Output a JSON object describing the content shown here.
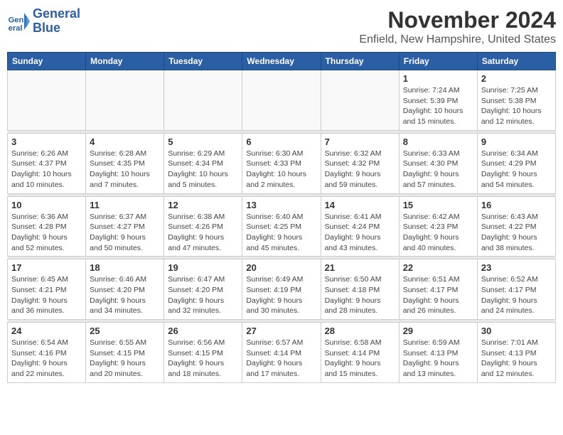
{
  "logo": {
    "line1": "General",
    "line2": "Blue"
  },
  "title": "November 2024",
  "location": "Enfield, New Hampshire, United States",
  "weekdays": [
    "Sunday",
    "Monday",
    "Tuesday",
    "Wednesday",
    "Thursday",
    "Friday",
    "Saturday"
  ],
  "weeks": [
    [
      {
        "day": "",
        "info": ""
      },
      {
        "day": "",
        "info": ""
      },
      {
        "day": "",
        "info": ""
      },
      {
        "day": "",
        "info": ""
      },
      {
        "day": "",
        "info": ""
      },
      {
        "day": "1",
        "info": "Sunrise: 7:24 AM\nSunset: 5:39 PM\nDaylight: 10 hours and 15 minutes."
      },
      {
        "day": "2",
        "info": "Sunrise: 7:25 AM\nSunset: 5:38 PM\nDaylight: 10 hours and 12 minutes."
      }
    ],
    [
      {
        "day": "3",
        "info": "Sunrise: 6:26 AM\nSunset: 4:37 PM\nDaylight: 10 hours and 10 minutes."
      },
      {
        "day": "4",
        "info": "Sunrise: 6:28 AM\nSunset: 4:35 PM\nDaylight: 10 hours and 7 minutes."
      },
      {
        "day": "5",
        "info": "Sunrise: 6:29 AM\nSunset: 4:34 PM\nDaylight: 10 hours and 5 minutes."
      },
      {
        "day": "6",
        "info": "Sunrise: 6:30 AM\nSunset: 4:33 PM\nDaylight: 10 hours and 2 minutes."
      },
      {
        "day": "7",
        "info": "Sunrise: 6:32 AM\nSunset: 4:32 PM\nDaylight: 9 hours and 59 minutes."
      },
      {
        "day": "8",
        "info": "Sunrise: 6:33 AM\nSunset: 4:30 PM\nDaylight: 9 hours and 57 minutes."
      },
      {
        "day": "9",
        "info": "Sunrise: 6:34 AM\nSunset: 4:29 PM\nDaylight: 9 hours and 54 minutes."
      }
    ],
    [
      {
        "day": "10",
        "info": "Sunrise: 6:36 AM\nSunset: 4:28 PM\nDaylight: 9 hours and 52 minutes."
      },
      {
        "day": "11",
        "info": "Sunrise: 6:37 AM\nSunset: 4:27 PM\nDaylight: 9 hours and 50 minutes."
      },
      {
        "day": "12",
        "info": "Sunrise: 6:38 AM\nSunset: 4:26 PM\nDaylight: 9 hours and 47 minutes."
      },
      {
        "day": "13",
        "info": "Sunrise: 6:40 AM\nSunset: 4:25 PM\nDaylight: 9 hours and 45 minutes."
      },
      {
        "day": "14",
        "info": "Sunrise: 6:41 AM\nSunset: 4:24 PM\nDaylight: 9 hours and 43 minutes."
      },
      {
        "day": "15",
        "info": "Sunrise: 6:42 AM\nSunset: 4:23 PM\nDaylight: 9 hours and 40 minutes."
      },
      {
        "day": "16",
        "info": "Sunrise: 6:43 AM\nSunset: 4:22 PM\nDaylight: 9 hours and 38 minutes."
      }
    ],
    [
      {
        "day": "17",
        "info": "Sunrise: 6:45 AM\nSunset: 4:21 PM\nDaylight: 9 hours and 36 minutes."
      },
      {
        "day": "18",
        "info": "Sunrise: 6:46 AM\nSunset: 4:20 PM\nDaylight: 9 hours and 34 minutes."
      },
      {
        "day": "19",
        "info": "Sunrise: 6:47 AM\nSunset: 4:20 PM\nDaylight: 9 hours and 32 minutes."
      },
      {
        "day": "20",
        "info": "Sunrise: 6:49 AM\nSunset: 4:19 PM\nDaylight: 9 hours and 30 minutes."
      },
      {
        "day": "21",
        "info": "Sunrise: 6:50 AM\nSunset: 4:18 PM\nDaylight: 9 hours and 28 minutes."
      },
      {
        "day": "22",
        "info": "Sunrise: 6:51 AM\nSunset: 4:17 PM\nDaylight: 9 hours and 26 minutes."
      },
      {
        "day": "23",
        "info": "Sunrise: 6:52 AM\nSunset: 4:17 PM\nDaylight: 9 hours and 24 minutes."
      }
    ],
    [
      {
        "day": "24",
        "info": "Sunrise: 6:54 AM\nSunset: 4:16 PM\nDaylight: 9 hours and 22 minutes."
      },
      {
        "day": "25",
        "info": "Sunrise: 6:55 AM\nSunset: 4:15 PM\nDaylight: 9 hours and 20 minutes."
      },
      {
        "day": "26",
        "info": "Sunrise: 6:56 AM\nSunset: 4:15 PM\nDaylight: 9 hours and 18 minutes."
      },
      {
        "day": "27",
        "info": "Sunrise: 6:57 AM\nSunset: 4:14 PM\nDaylight: 9 hours and 17 minutes."
      },
      {
        "day": "28",
        "info": "Sunrise: 6:58 AM\nSunset: 4:14 PM\nDaylight: 9 hours and 15 minutes."
      },
      {
        "day": "29",
        "info": "Sunrise: 6:59 AM\nSunset: 4:13 PM\nDaylight: 9 hours and 13 minutes."
      },
      {
        "day": "30",
        "info": "Sunrise: 7:01 AM\nSunset: 4:13 PM\nDaylight: 9 hours and 12 minutes."
      }
    ]
  ]
}
